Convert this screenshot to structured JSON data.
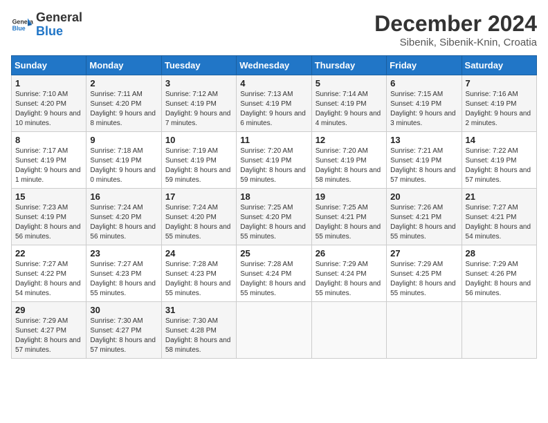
{
  "logo": {
    "general": "General",
    "blue": "Blue"
  },
  "header": {
    "month": "December 2024",
    "location": "Sibenik, Sibenik-Knin, Croatia"
  },
  "weekdays": [
    "Sunday",
    "Monday",
    "Tuesday",
    "Wednesday",
    "Thursday",
    "Friday",
    "Saturday"
  ],
  "weeks": [
    [
      {
        "day": "1",
        "sunrise": "7:10 AM",
        "sunset": "4:20 PM",
        "daylight": "9 hours and 10 minutes."
      },
      {
        "day": "2",
        "sunrise": "7:11 AM",
        "sunset": "4:20 PM",
        "daylight": "9 hours and 8 minutes."
      },
      {
        "day": "3",
        "sunrise": "7:12 AM",
        "sunset": "4:19 PM",
        "daylight": "9 hours and 7 minutes."
      },
      {
        "day": "4",
        "sunrise": "7:13 AM",
        "sunset": "4:19 PM",
        "daylight": "9 hours and 6 minutes."
      },
      {
        "day": "5",
        "sunrise": "7:14 AM",
        "sunset": "4:19 PM",
        "daylight": "9 hours and 4 minutes."
      },
      {
        "day": "6",
        "sunrise": "7:15 AM",
        "sunset": "4:19 PM",
        "daylight": "9 hours and 3 minutes."
      },
      {
        "day": "7",
        "sunrise": "7:16 AM",
        "sunset": "4:19 PM",
        "daylight": "9 hours and 2 minutes."
      }
    ],
    [
      {
        "day": "8",
        "sunrise": "7:17 AM",
        "sunset": "4:19 PM",
        "daylight": "9 hours and 1 minute."
      },
      {
        "day": "9",
        "sunrise": "7:18 AM",
        "sunset": "4:19 PM",
        "daylight": "9 hours and 0 minutes."
      },
      {
        "day": "10",
        "sunrise": "7:19 AM",
        "sunset": "4:19 PM",
        "daylight": "8 hours and 59 minutes."
      },
      {
        "day": "11",
        "sunrise": "7:20 AM",
        "sunset": "4:19 PM",
        "daylight": "8 hours and 59 minutes."
      },
      {
        "day": "12",
        "sunrise": "7:20 AM",
        "sunset": "4:19 PM",
        "daylight": "8 hours and 58 minutes."
      },
      {
        "day": "13",
        "sunrise": "7:21 AM",
        "sunset": "4:19 PM",
        "daylight": "8 hours and 57 minutes."
      },
      {
        "day": "14",
        "sunrise": "7:22 AM",
        "sunset": "4:19 PM",
        "daylight": "8 hours and 57 minutes."
      }
    ],
    [
      {
        "day": "15",
        "sunrise": "7:23 AM",
        "sunset": "4:19 PM",
        "daylight": "8 hours and 56 minutes."
      },
      {
        "day": "16",
        "sunrise": "7:24 AM",
        "sunset": "4:20 PM",
        "daylight": "8 hours and 56 minutes."
      },
      {
        "day": "17",
        "sunrise": "7:24 AM",
        "sunset": "4:20 PM",
        "daylight": "8 hours and 55 minutes."
      },
      {
        "day": "18",
        "sunrise": "7:25 AM",
        "sunset": "4:20 PM",
        "daylight": "8 hours and 55 minutes."
      },
      {
        "day": "19",
        "sunrise": "7:25 AM",
        "sunset": "4:21 PM",
        "daylight": "8 hours and 55 minutes."
      },
      {
        "day": "20",
        "sunrise": "7:26 AM",
        "sunset": "4:21 PM",
        "daylight": "8 hours and 55 minutes."
      },
      {
        "day": "21",
        "sunrise": "7:27 AM",
        "sunset": "4:21 PM",
        "daylight": "8 hours and 54 minutes."
      }
    ],
    [
      {
        "day": "22",
        "sunrise": "7:27 AM",
        "sunset": "4:22 PM",
        "daylight": "8 hours and 54 minutes."
      },
      {
        "day": "23",
        "sunrise": "7:27 AM",
        "sunset": "4:23 PM",
        "daylight": "8 hours and 55 minutes."
      },
      {
        "day": "24",
        "sunrise": "7:28 AM",
        "sunset": "4:23 PM",
        "daylight": "8 hours and 55 minutes."
      },
      {
        "day": "25",
        "sunrise": "7:28 AM",
        "sunset": "4:24 PM",
        "daylight": "8 hours and 55 minutes."
      },
      {
        "day": "26",
        "sunrise": "7:29 AM",
        "sunset": "4:24 PM",
        "daylight": "8 hours and 55 minutes."
      },
      {
        "day": "27",
        "sunrise": "7:29 AM",
        "sunset": "4:25 PM",
        "daylight": "8 hours and 55 minutes."
      },
      {
        "day": "28",
        "sunrise": "7:29 AM",
        "sunset": "4:26 PM",
        "daylight": "8 hours and 56 minutes."
      }
    ],
    [
      {
        "day": "29",
        "sunrise": "7:29 AM",
        "sunset": "4:27 PM",
        "daylight": "8 hours and 57 minutes."
      },
      {
        "day": "30",
        "sunrise": "7:30 AM",
        "sunset": "4:27 PM",
        "daylight": "8 hours and 57 minutes."
      },
      {
        "day": "31",
        "sunrise": "7:30 AM",
        "sunset": "4:28 PM",
        "daylight": "8 hours and 58 minutes."
      },
      null,
      null,
      null,
      null
    ]
  ]
}
